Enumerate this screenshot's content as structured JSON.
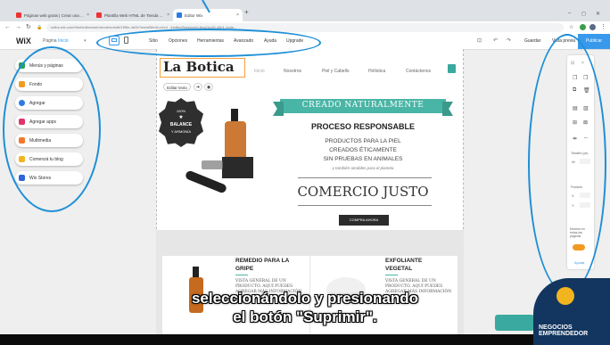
{
  "tabs": [
    {
      "label": "Páginas web gratis | Crear una ...",
      "fav": "#e33"
    },
    {
      "label": "Plantilla Web HTML de Tienda ...",
      "fav": "#e33"
    },
    {
      "label": "Editor Wix",
      "fav": "#2b7be4"
    }
  ],
  "url": "editor.wix.com/html/editor/web/renderer/edit/1f96e-4d2b?metaSiteId=c4c4...&editorSessionId=6ea2a1d5-4db1-4a4e...",
  "wix": {
    "logo": "WiX",
    "page_label": "Página",
    "page_name": "Inicio",
    "menu": [
      "Sitio",
      "Opciones",
      "Herramientas",
      "Avanzado",
      "Ayuda",
      "Upgrade"
    ],
    "save": "Guardar",
    "preview": "Vista previa",
    "publish": "Publicar"
  },
  "left_panel": [
    {
      "label": "Menús y páginas",
      "color": "#2aa34a"
    },
    {
      "label": "Fondo",
      "color": "#f29a21"
    },
    {
      "label": "Agregar",
      "color": "#2e7be4"
    },
    {
      "label": "Agregar apps",
      "color": "#e0356b"
    },
    {
      "label": "Multimedia",
      "color": "#f4772b"
    },
    {
      "label": "Comenzá tu blog",
      "color": "#f2b520"
    },
    {
      "label": "Wix Stores",
      "color": "#2f63d8"
    }
  ],
  "site": {
    "logo": "La Botica",
    "nav": [
      "Inicio",
      "Nosotros",
      "Piel y Cabello",
      "Holística",
      "Contáctenos"
    ],
    "edit_text_button": "Editar texto",
    "badge": [
      "100%",
      "BALANCE",
      "Y ARMONÍA"
    ],
    "ribbon": "CREADO NATURALMENTE",
    "proceso": "PROCESO RESPONSABLE",
    "lines": [
      "PRODUCTOS PARA LA PIEL",
      "CREADOS ÉTICAMENTE",
      "SIN PRUEBAS EN ANIMALES"
    ],
    "italic": "y también amables para el planeta",
    "comercio": "COMERCIO JUSTO",
    "shop_button": "COMPRA AHORA",
    "cards": [
      {
        "title": [
          "REMEDIO PARA LA",
          "GRIPE"
        ],
        "body": [
          "VISTA GENERAL DE UN",
          "PRODUCTO. AQUÍ PUEDES",
          "AGREGAR MÁS INFORMACIÓN"
        ]
      },
      {
        "title": [
          "EXFOLIANTE",
          "VEGETAL"
        ],
        "body": [
          "VISTA GENERAL DE UN",
          "PRODUCTO. AQUÍ PUEDES",
          "AGREGAR MÁS INFORMACIÓN"
        ]
      }
    ]
  },
  "right_panel": {
    "size_label": "Tamaño (px)",
    "position_label": "Posición",
    "labels": [
      "W",
      "X",
      "Y"
    ],
    "toggle_label": "Mostrar en todas las páginas",
    "help": "Ayuda"
  },
  "caption": [
    "seleccionándolo y presionando",
    "el botón \"Suprimir\"."
  ],
  "brand": "NEGOCIOS\nEMPRENDEDOR"
}
